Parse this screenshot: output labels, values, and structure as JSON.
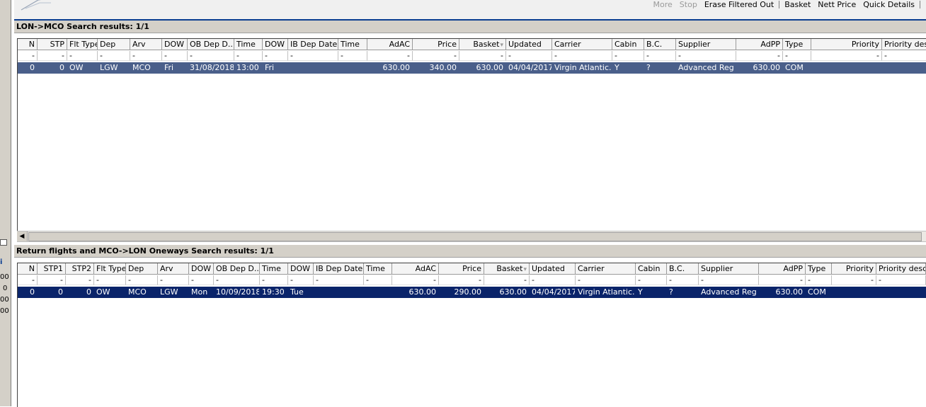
{
  "menu": {
    "more": "More",
    "stop": "Stop",
    "erase": "Erase Filtered Out",
    "basket": "Basket",
    "nett_price": "Nett Price",
    "quick_details": "Quick Details"
  },
  "left_strip": [
    "i",
    "00",
    "0",
    "00",
    "00"
  ],
  "outbound": {
    "title": "LON->MCO Search results: 1/1",
    "headers": [
      "N",
      "STP",
      "Flt Type",
      "Dep",
      "Arv",
      "DOW",
      "OB Dep D...",
      "Time",
      "DOW",
      "IB Dep Date",
      "Time",
      "AdAC",
      "Price",
      "Basket",
      "Updated",
      "Carrier",
      "Cabin",
      "B.C.",
      "Supplier",
      "AdPP",
      "Type",
      "Priority",
      "Priority description"
    ],
    "filter": [
      "-",
      "-",
      "-",
      "-",
      "-",
      "-",
      "-",
      "-",
      "-",
      "-",
      "-",
      "-",
      "-",
      "-",
      "-",
      "-",
      "-",
      "-",
      "-",
      "-",
      "-",
      "-",
      "-"
    ],
    "rows": [
      [
        "0",
        "0",
        "OW",
        "LGW",
        "MCO",
        "Fri",
        "31/08/2018",
        "13:00",
        "Fri",
        "",
        "",
        "630.00",
        "340.00",
        "630.00",
        "04/04/2017",
        "Virgin Atlantic...",
        "Y",
        "?",
        "Advanced Reg",
        "630.00",
        "COM",
        "",
        ""
      ]
    ]
  },
  "return": {
    "title": "Return flights and MCO->LON Oneways Search results: 1/1",
    "headers": [
      "N",
      "STP1",
      "STP2",
      "Flt Type",
      "Dep",
      "Arv",
      "DOW",
      "OB Dep D...",
      "Time",
      "DOW",
      "IB Dep Date",
      "Time",
      "AdAC",
      "Price",
      "Basket",
      "Updated",
      "Carrier",
      "Cabin",
      "B.C.",
      "Supplier",
      "AdPP",
      "Type",
      "Priority",
      "Priority descri"
    ],
    "filter": [
      "-",
      "-",
      "-",
      "-",
      "-",
      "-",
      "-",
      "-",
      "-",
      "-",
      "-",
      "-",
      "-",
      "-",
      "-",
      "-",
      "-",
      "-",
      "-",
      "-",
      "-",
      "-",
      "-",
      "-"
    ],
    "rows": [
      [
        "0",
        "0",
        "0",
        "OW",
        "MCO",
        "LGW",
        "Mon",
        "10/09/2018",
        "19:30",
        "Tue",
        "",
        "",
        "630.00",
        "290.00",
        "630.00",
        "04/04/2017",
        "Virgin Atlantic...",
        "Y",
        "?",
        "Advanced Reg",
        "630.00",
        "COM",
        "",
        ""
      ]
    ]
  },
  "colors": {
    "selected_inactive": "#4a5f8a",
    "selected_active": "#0a246a",
    "title_bg": "#d4d0c8"
  }
}
